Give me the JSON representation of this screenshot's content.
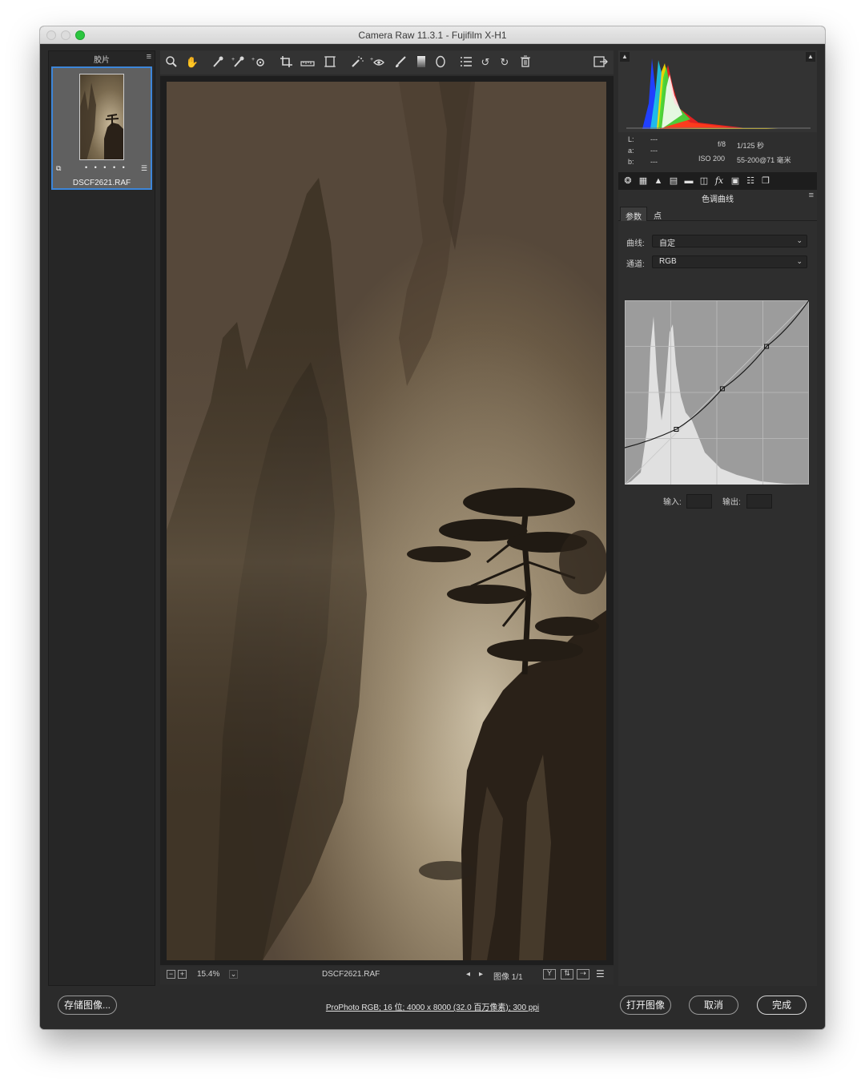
{
  "window": {
    "title": "Camera Raw 11.3.1 -  Fujifilm X-H1"
  },
  "filmstrip": {
    "label": "胶片",
    "menu_icon": "≡",
    "thumbnail": {
      "filename": "DSCF2621.RAF",
      "rating_dots": "• • • • •"
    }
  },
  "toolbar": {
    "tools": [
      "zoom-icon",
      "hand-icon",
      "white-balance-icon",
      "color-sampler-icon",
      "targeted-adjust-icon",
      "crop-icon",
      "straighten-icon",
      "transform-icon",
      "spot-removal-icon",
      "red-eye-icon",
      "adjustment-brush-icon",
      "graduated-filter-icon",
      "radial-filter-icon",
      "preferences-icon",
      "rotate-ccw-icon",
      "rotate-cw-icon",
      "trash-icon",
      "fullscreen-icon"
    ]
  },
  "preview_status": {
    "zoom_minus": "−",
    "zoom_plus": "+",
    "zoom": "15.4%",
    "zoom_dropdown": "⌄",
    "filename": "DSCF2621.RAF",
    "prev": "◂",
    "next": "▸",
    "image_counter": "图像 1/1"
  },
  "histogram": {
    "info": {
      "L_label": "L:",
      "L_value": "---",
      "a_label": "a:",
      "a_value": "---",
      "b_label": "b:",
      "b_value": "---",
      "aperture": "f/8",
      "shutter": "1/125 秒",
      "iso": "ISO 200",
      "lens": "55-200@71 毫米"
    }
  },
  "panel": {
    "title": "色调曲线",
    "menu_icon": "≡",
    "tabs": [
      "参数",
      "点"
    ],
    "active_tab": "参数",
    "curve_label": "曲线:",
    "curve_value": "自定",
    "channel_label": "通道:",
    "channel_value": "RGB",
    "input_label": "输入:",
    "output_label": "输出:",
    "input_value": "",
    "output_value": "",
    "curve_points": [
      [
        0,
        0.2
      ],
      [
        0.28,
        0.3
      ],
      [
        0.53,
        0.52
      ],
      [
        0.77,
        0.75
      ],
      [
        1,
        1
      ]
    ]
  },
  "bottom": {
    "save_button": "存储图像...",
    "workflow_text": "ProPhoto RGB; 16 位;  4000 x 8000 (32.0 百万像素); 300 ppi",
    "open_button": "打开图像",
    "cancel_button": "取消",
    "done_button": "完成"
  }
}
